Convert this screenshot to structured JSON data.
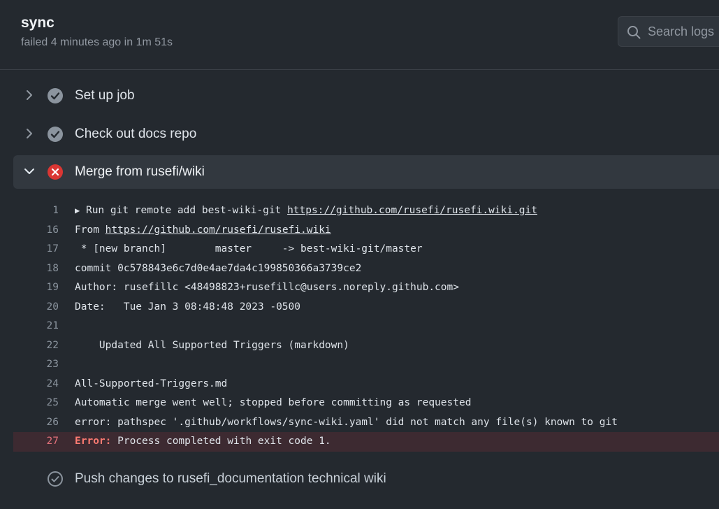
{
  "header": {
    "title": "sync",
    "status": "failed 4 minutes ago in 1m 51s",
    "search_placeholder": "Search logs"
  },
  "steps": [
    {
      "label": "Set up job",
      "status": "success"
    },
    {
      "label": "Check out docs repo",
      "status": "success"
    },
    {
      "label": "Merge from rusefi/wiki",
      "status": "failure"
    }
  ],
  "log": {
    "lines": [
      {
        "n": "1",
        "run": "Run git remote add best-wiki-git ",
        "url": "https://github.com/rusefi/rusefi.wiki.git"
      },
      {
        "n": "16",
        "prefix": "From ",
        "url": "https://github.com/rusefi/rusefi.wiki"
      },
      {
        "n": "17",
        "text": " * [new branch]        master     -> best-wiki-git/master"
      },
      {
        "n": "18",
        "text": "commit 0c578843e6c7d0e4ae7da4c199850366a3739ce2"
      },
      {
        "n": "19",
        "text": "Author: rusefillc <48498823+rusefillc@users.noreply.github.com>"
      },
      {
        "n": "20",
        "text": "Date:   Tue Jan 3 08:48:48 2023 -0500"
      },
      {
        "n": "21",
        "text": ""
      },
      {
        "n": "22",
        "text": "    Updated All Supported Triggers (markdown)"
      },
      {
        "n": "23",
        "text": ""
      },
      {
        "n": "24",
        "text": "All-Supported-Triggers.md"
      },
      {
        "n": "25",
        "text": "Automatic merge went well; stopped before committing as requested"
      },
      {
        "n": "26",
        "text": "error: pathspec '.github/workflows/sync-wiki.yaml' did not match any file(s) known to git"
      },
      {
        "n": "27",
        "error_label": "Error:",
        "text": " Process completed with exit code 1."
      }
    ]
  },
  "next_step": {
    "label": "Push changes to rusefi_documentation technical wiki"
  },
  "colors": {
    "success": "#8b949e",
    "failure": "#da3633",
    "background": "#24292f"
  }
}
